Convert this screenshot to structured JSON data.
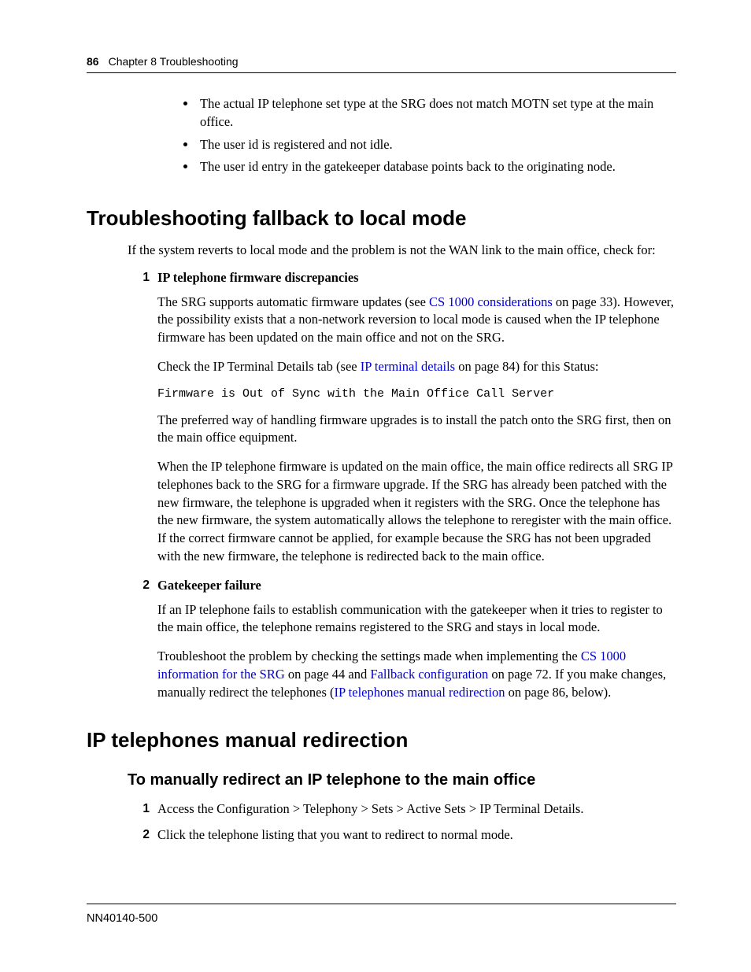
{
  "header": {
    "page_number": "86",
    "chapter": "Chapter 8  Troubleshooting"
  },
  "top_bullets": [
    "The actual IP telephone set type at the SRG does not match MOTN set type at the main office.",
    "The user id is registered and not idle.",
    "The user id entry in the gatekeeper database points back to the originating node."
  ],
  "sec1": {
    "title": "Troubleshooting fallback to local mode",
    "intro": "If the system reverts to local mode and the problem is not the WAN link to the main office, check for:",
    "items": [
      {
        "num": "1",
        "label": "IP telephone firmware discrepancies",
        "p1_a": "The SRG supports automatic firmware updates (see ",
        "p1_link": "CS 1000 considerations",
        "p1_b": " on page 33). However, the possibility exists that a non-network reversion to local mode is caused when the IP telephone firmware has been updated on the main office and not on the SRG.",
        "p2_a": "Check the IP Terminal Details tab (see ",
        "p2_link": "IP terminal details",
        "p2_b": " on page 84) for this Status:",
        "code": "Firmware is Out of Sync with the Main Office Call Server",
        "p3": "The preferred way of handling firmware upgrades is to install the patch onto the SRG first, then on the main office equipment.",
        "p4": "When the IP telephone firmware is updated on the main office, the main office redirects all SRG IP telephones back to the SRG for a firmware upgrade. If the SRG has already been patched with the new firmware, the telephone is upgraded when it registers with the SRG. Once the telephone has the new firmware, the system automatically allows the telephone to reregister with the main office. If the correct firmware cannot be applied, for example because the SRG has not been upgraded with the new firmware, the telephone is redirected back to the main office."
      },
      {
        "num": "2",
        "label": "Gatekeeper failure",
        "p1": "If an IP telephone fails to establish communication with the gatekeeper when it tries to register to the main office, the telephone remains registered to the SRG and stays in local mode.",
        "p2_a": "Troubleshoot the problem by checking the settings made when implementing the ",
        "p2_link1": "CS 1000 information for the SRG",
        "p2_b": " on page 44 and ",
        "p2_link2": "Fallback configuration",
        "p2_c": " on page 72. If you make changes, manually redirect the telephones (",
        "p2_link3": "IP telephones manual redirection",
        "p2_d": " on page 86, below)."
      }
    ]
  },
  "sec2": {
    "title": "IP telephones manual redirection",
    "subtitle": "To manually redirect an IP telephone to the main office",
    "steps": [
      {
        "num": "1",
        "text": "Access the Configuration > Telephony > Sets > Active Sets > IP Terminal Details."
      },
      {
        "num": "2",
        "text": "Click the telephone listing that you want to redirect to normal mode."
      }
    ]
  },
  "footer": {
    "docid": "NN40140-500"
  }
}
